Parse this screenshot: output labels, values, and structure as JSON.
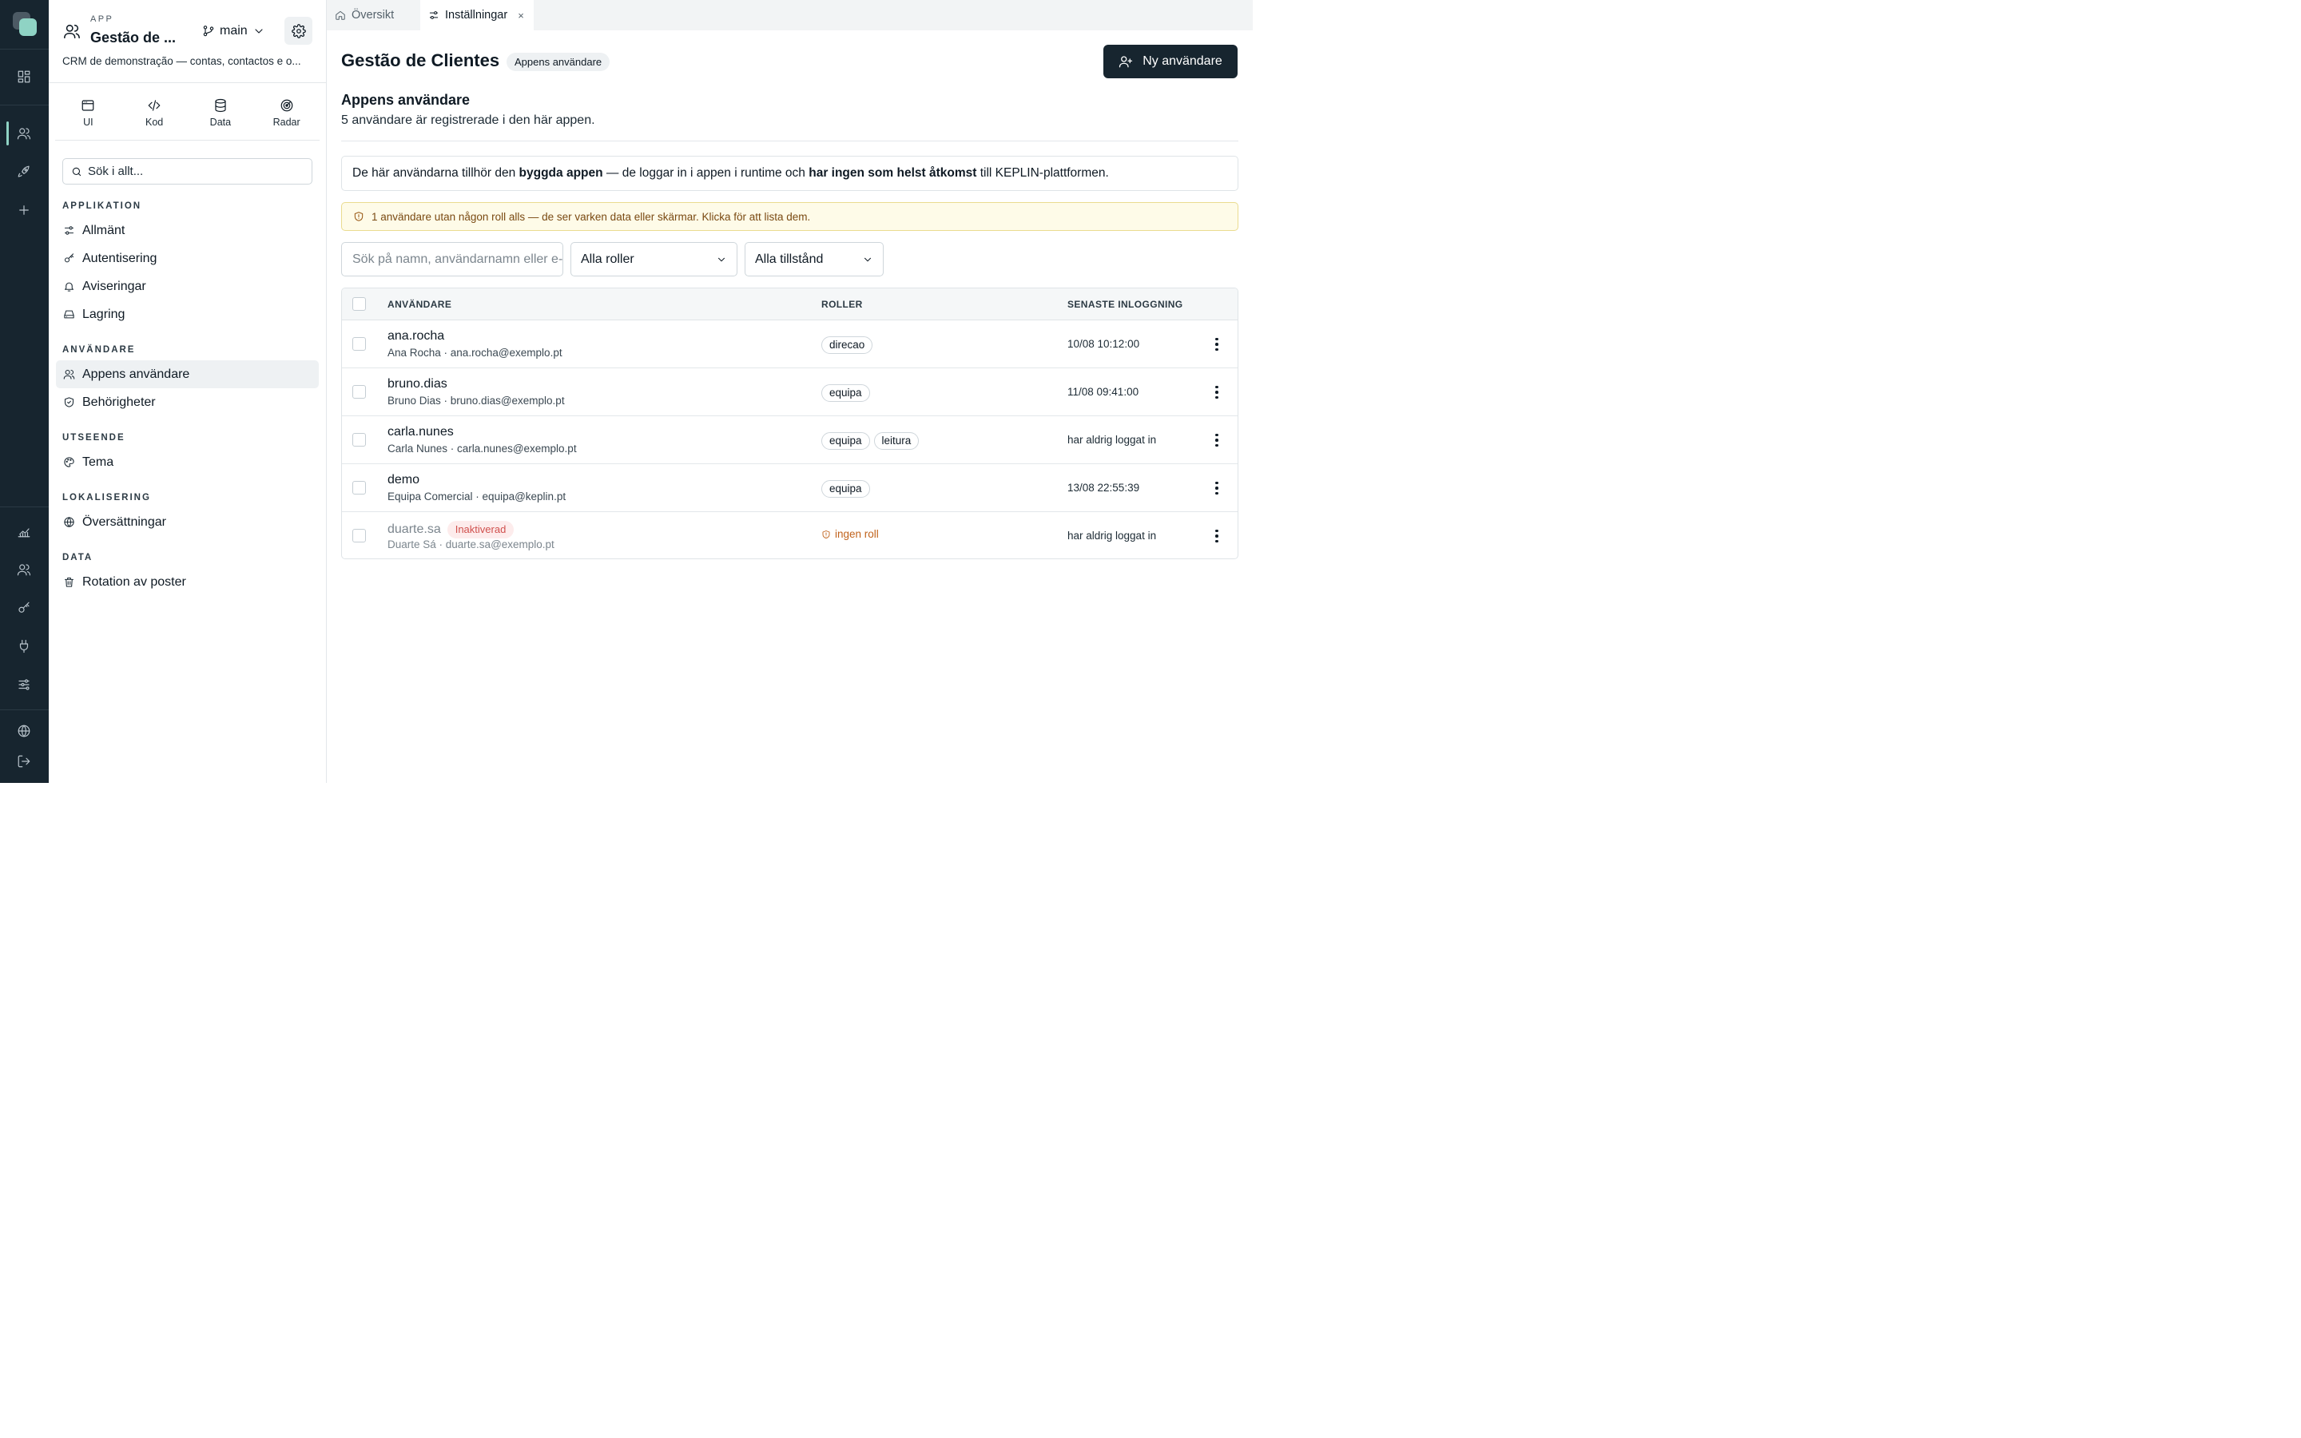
{
  "app": {
    "kicker": "APP",
    "name": "Gestão de ...",
    "branch": "main",
    "description": "CRM de demonstração — contas, contactos e o..."
  },
  "modes": [
    {
      "label": "UI",
      "icon": "window-icon"
    },
    {
      "label": "Kod",
      "icon": "code-icon"
    },
    {
      "label": "Data",
      "icon": "database-icon"
    },
    {
      "label": "Radar",
      "icon": "radar-icon"
    }
  ],
  "search": {
    "placeholder": "Sök i allt..."
  },
  "nav": {
    "sections": [
      {
        "title": "APPLIKATION",
        "items": [
          "Allmänt",
          "Autentisering",
          "Aviseringar",
          "Lagring"
        ]
      },
      {
        "title": "ANVÄNDARE",
        "items": [
          "Appens användare",
          "Behörigheter"
        ]
      },
      {
        "title": "UTSEENDE",
        "items": [
          "Tema"
        ]
      },
      {
        "title": "LOKALISERING",
        "items": [
          "Översättningar"
        ]
      },
      {
        "title": "DATA",
        "items": [
          "Rotation av poster"
        ]
      }
    ],
    "active": "Appens användare"
  },
  "tabs": [
    {
      "label": "Översikt",
      "icon": "home-icon"
    },
    {
      "label": "Inställningar",
      "icon": "sliders-icon",
      "close": "×"
    }
  ],
  "header": {
    "title": "Gestão de Clientes",
    "badge": "Appens användare",
    "new_button": "Ny användare"
  },
  "section": {
    "title": "Appens användare",
    "subtitle": "5 användare är registrerade i den här appen."
  },
  "info": {
    "part1": "De här användarna tillhör den ",
    "bold1": "byggda appen",
    "part2": " — de loggar in i appen i runtime och ",
    "bold2": "har ingen som helst åtkomst",
    "part3": " till KEPLIN-plattformen."
  },
  "warning": "1 användare utan någon roll alls — de ser varken data eller skärmar. Klicka för att lista dem.",
  "filters": {
    "search_placeholder": "Sök på namn, användarnamn eller e-post",
    "roles": "Alla roller",
    "states": "Alla tillstånd"
  },
  "table": {
    "columns": [
      "ANVÄNDARE",
      "ROLLER",
      "SENASTE INLOGGNING"
    ],
    "rows": [
      {
        "username": "ana.rocha",
        "meta": "Ana Rocha · ana.rocha@exemplo.pt",
        "roles": [
          "direcao"
        ],
        "last_login": "10/08 10:12:00"
      },
      {
        "username": "bruno.dias",
        "meta": "Bruno Dias · bruno.dias@exemplo.pt",
        "roles": [
          "equipa"
        ],
        "last_login": "11/08 09:41:00"
      },
      {
        "username": "carla.nunes",
        "meta": "Carla Nunes · carla.nunes@exemplo.pt",
        "roles": [
          "equipa",
          "leitura"
        ],
        "last_login": "har aldrig loggat in"
      },
      {
        "username": "demo",
        "meta": "Equipa Comercial · equipa@keplin.pt",
        "roles": [
          "equipa"
        ],
        "last_login": "13/08 22:55:39"
      },
      {
        "username": "duarte.sa",
        "status": "Inaktiverad",
        "meta": "Duarte Sá · duarte.sa@exemplo.pt",
        "roles": [],
        "no_role": "ingen roll",
        "last_login": "har aldrig loggat in"
      }
    ]
  },
  "colors": {
    "rail": "#17252f",
    "accent": "#8fd3c4",
    "primary_button": "#17252f",
    "warning_bg": "#fefbe8",
    "inactive_badge": "#d0504d",
    "no_role": "#c0621b"
  }
}
